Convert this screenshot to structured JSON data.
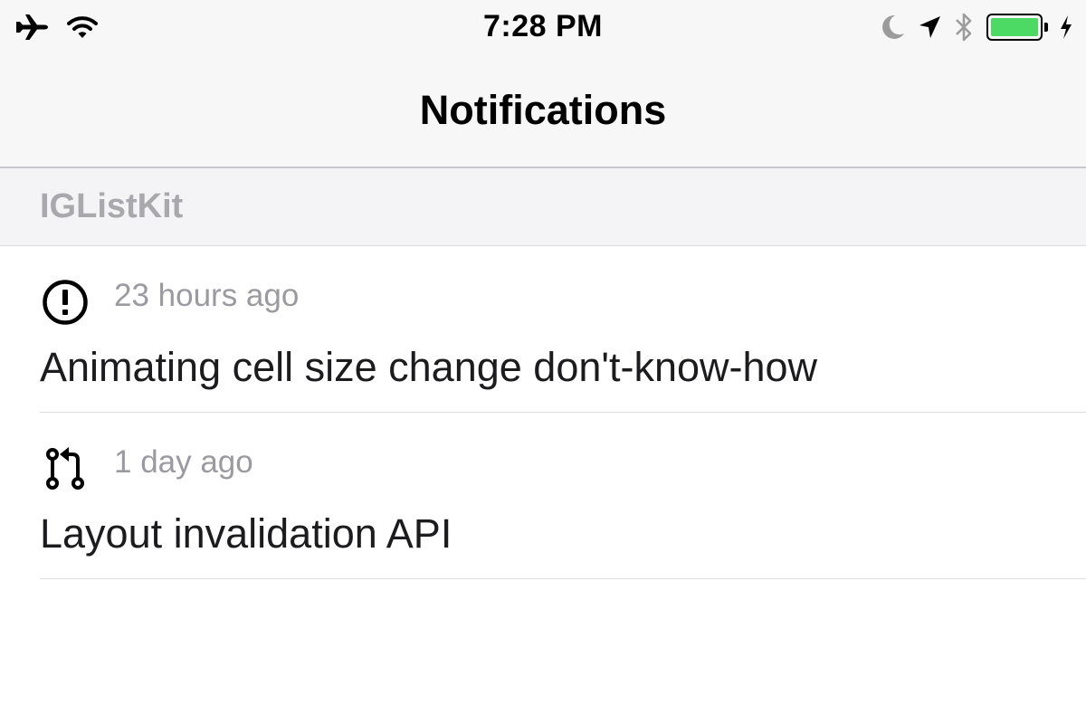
{
  "status_bar": {
    "time": "7:28 PM",
    "left_icons": [
      "airplane-icon",
      "wifi-icon"
    ],
    "right_icons": [
      "moon-icon",
      "location-arrow-icon",
      "bluetooth-icon",
      "battery-icon",
      "charging-bolt-icon"
    ],
    "battery_color": "#4cd964"
  },
  "nav": {
    "title": "Notifications"
  },
  "sections": [
    {
      "title": "IGListKit",
      "items": [
        {
          "icon": "issue-opened-icon",
          "time": "23 hours ago",
          "title": "Animating cell size change don't-know-how"
        },
        {
          "icon": "pull-request-icon",
          "time": "1 day ago",
          "title": "Layout invalidation API"
        }
      ]
    }
  ],
  "colors": {
    "bar_background": "#f7f7f7",
    "section_background": "#f4f4f6",
    "secondary_text": "#9a9aa0",
    "separator": "#dcdcdc"
  }
}
